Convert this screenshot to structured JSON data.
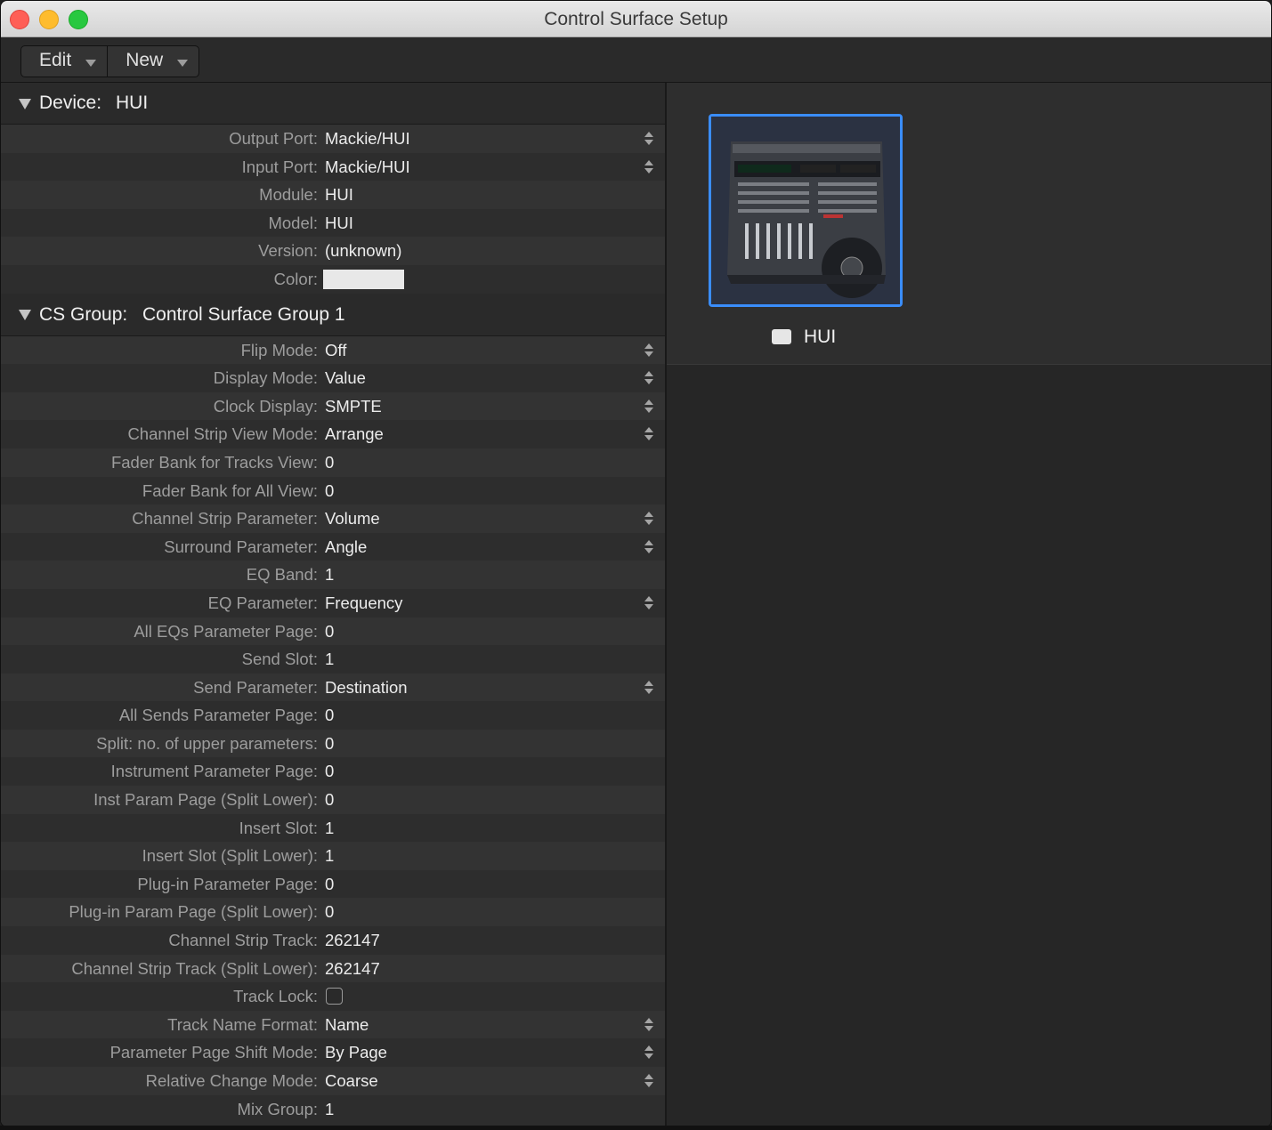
{
  "window": {
    "title": "Control Surface Setup"
  },
  "toolbar": {
    "menus": [
      {
        "label": "Edit"
      },
      {
        "label": "New"
      }
    ]
  },
  "device": {
    "section_label": "Device:",
    "section_value": "HUI",
    "rows": [
      {
        "label": "Output Port:",
        "value": "Mackie/HUI",
        "type": "popup"
      },
      {
        "label": "Input Port:",
        "value": "Mackie/HUI",
        "type": "popup"
      },
      {
        "label": "Module:",
        "value": "HUI",
        "type": "text"
      },
      {
        "label": "Model:",
        "value": "HUI",
        "type": "text"
      },
      {
        "label": "Version:",
        "value": "(unknown)",
        "type": "text"
      },
      {
        "label": "Color:",
        "value": "",
        "type": "color",
        "color": "#e8e8e8"
      }
    ]
  },
  "cs_group": {
    "section_label": "CS Group:",
    "section_value": "Control Surface Group 1",
    "rows": [
      {
        "label": "Flip Mode:",
        "value": "Off",
        "type": "popup"
      },
      {
        "label": "Display Mode:",
        "value": "Value",
        "type": "popup"
      },
      {
        "label": "Clock Display:",
        "value": "SMPTE",
        "type": "popup"
      },
      {
        "label": "Channel Strip View Mode:",
        "value": "Arrange",
        "type": "popup"
      },
      {
        "label": "Fader Bank for Tracks View:",
        "value": "0",
        "type": "number"
      },
      {
        "label": "Fader Bank for All View:",
        "value": "0",
        "type": "number"
      },
      {
        "label": "Channel Strip Parameter:",
        "value": "Volume",
        "type": "popup"
      },
      {
        "label": "Surround Parameter:",
        "value": "Angle",
        "type": "popup"
      },
      {
        "label": "EQ Band:",
        "value": "1",
        "type": "number"
      },
      {
        "label": "EQ Parameter:",
        "value": "Frequency",
        "type": "popup"
      },
      {
        "label": "All EQs Parameter Page:",
        "value": "0",
        "type": "number"
      },
      {
        "label": "Send Slot:",
        "value": "1",
        "type": "number"
      },
      {
        "label": "Send Parameter:",
        "value": "Destination",
        "type": "popup"
      },
      {
        "label": "All Sends Parameter Page:",
        "value": "0",
        "type": "number"
      },
      {
        "label": "Split: no. of upper parameters:",
        "value": "0",
        "type": "number"
      },
      {
        "label": "Instrument Parameter Page:",
        "value": "0",
        "type": "number"
      },
      {
        "label": "Inst Param Page (Split Lower):",
        "value": "0",
        "type": "number"
      },
      {
        "label": "Insert Slot:",
        "value": "1",
        "type": "number"
      },
      {
        "label": "Insert Slot (Split Lower):",
        "value": "1",
        "type": "number"
      },
      {
        "label": "Plug-in Parameter Page:",
        "value": "0",
        "type": "number"
      },
      {
        "label": "Plug-in Param Page (Split Lower):",
        "value": "0",
        "type": "number"
      },
      {
        "label": "Channel Strip Track:",
        "value": "262147",
        "type": "number"
      },
      {
        "label": "Channel Strip Track (Split Lower):",
        "value": "262147",
        "type": "number"
      },
      {
        "label": "Track Lock:",
        "value": "",
        "type": "checkbox",
        "checked": false
      },
      {
        "label": "Track Name Format:",
        "value": "Name",
        "type": "popup"
      },
      {
        "label": "Parameter Page Shift Mode:",
        "value": "By Page",
        "type": "popup"
      },
      {
        "label": "Relative Change Mode:",
        "value": "Coarse",
        "type": "popup"
      },
      {
        "label": "Mix Group:",
        "value": "1",
        "type": "number"
      }
    ]
  },
  "devices_panel": {
    "selected_device": {
      "name": "HUI",
      "icon": "hui-control-surface-icon",
      "color": "#e6e6e6",
      "selection_color": "#3a8dfa"
    }
  },
  "colors": {
    "selection": "#3a8dfa",
    "label": "#9d9d9d",
    "value": "#ececec"
  }
}
